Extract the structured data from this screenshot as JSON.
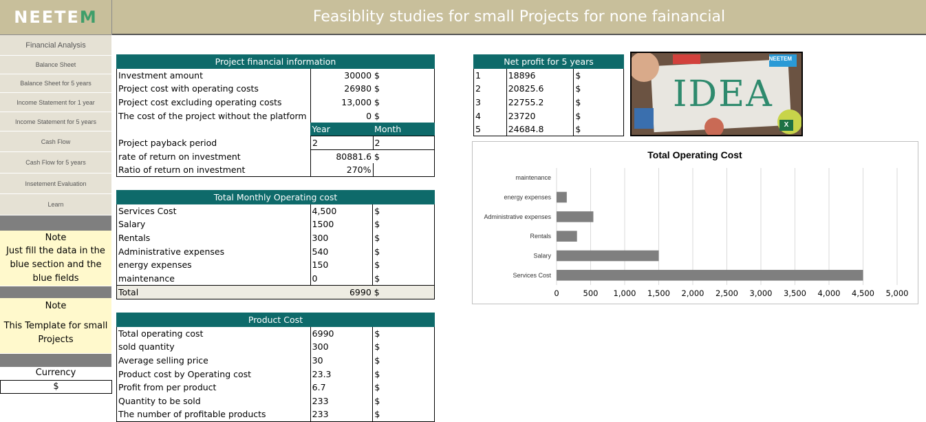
{
  "brand": {
    "logo_text": "NEETE",
    "logo_m": "M"
  },
  "header": {
    "title": "Feasiblity studies for small Projects for none fainancial"
  },
  "sidebar": {
    "items": [
      {
        "label": "Financial Analysis"
      },
      {
        "label": "Balance Sheet"
      },
      {
        "label": "Balance Sheet for 5 years"
      },
      {
        "label": "Income Statement for 1 year"
      },
      {
        "label": "Income Statement for 5 years"
      },
      {
        "label": "Cash Flow"
      },
      {
        "label": "Cash Flow for 5 years"
      },
      {
        "label": "Insetement Evaluation"
      },
      {
        "label": "Learn"
      }
    ],
    "note1_title": "Note",
    "note1_body": "Just fill the data in the blue section and the blue fields",
    "note2_title": "Note",
    "note2_body": "This Template for small Projects",
    "currency_label": "Currency",
    "currency_value": "$"
  },
  "project_info": {
    "title": "Project financial information",
    "rows": [
      {
        "label": "Investment amount",
        "value": "30000",
        "unit": "$"
      },
      {
        "label": "Project cost with operating costs",
        "value": "26980",
        "unit": "$"
      },
      {
        "label": "Project cost excluding operating costs",
        "value": "13,000",
        "unit": "$"
      },
      {
        "label": "The cost of the project without the platform",
        "value": "0",
        "unit": "$"
      }
    ],
    "year_header": "Year",
    "month_header": "Month",
    "payback_label": "Project payback period",
    "payback_year": "2",
    "payback_month": "2",
    "rate_label": "rate of return on investment",
    "rate_value": "80881.6",
    "rate_unit": "$",
    "ratio_label": "Ratio of return on investment",
    "ratio_value": "270%"
  },
  "operating_cost": {
    "title": "Total Monthly Operating cost",
    "rows": [
      {
        "label": "Services Cost",
        "value": "4,500",
        "unit": "$"
      },
      {
        "label": "Salary",
        "value": "1500",
        "unit": "$"
      },
      {
        "label": "Rentals",
        "value": "300",
        "unit": "$"
      },
      {
        "label": "Administrative expenses",
        "value": "540",
        "unit": "$"
      },
      {
        "label": "energy expenses",
        "value": "150",
        "unit": "$"
      },
      {
        "label": "maintenance",
        "value": "0",
        "unit": "$"
      }
    ],
    "total_label": "Total",
    "total_value": "6990",
    "total_unit": "$"
  },
  "product_cost": {
    "title": "Product Cost",
    "rows": [
      {
        "label": "Total operating cost",
        "value": "6990",
        "unit": "$"
      },
      {
        "label": "sold quantity",
        "value": "300",
        "unit": "$"
      },
      {
        "label": "Average selling price",
        "value": "30",
        "unit": "$"
      },
      {
        "label": "Product cost by Operating cost",
        "value": "23.3",
        "unit": "$"
      },
      {
        "label": "Profit from per product",
        "value": "6.7",
        "unit": "$"
      },
      {
        "label": "Quantity to be sold",
        "value": "233",
        "unit": "$"
      },
      {
        "label": "The number of profitable products",
        "value": "233",
        "unit": "$"
      }
    ]
  },
  "net_profit": {
    "title": "Net profit for 5 years",
    "rows": [
      {
        "year": "1",
        "value": "18896",
        "unit": "$"
      },
      {
        "year": "2",
        "value": "20825.6",
        "unit": "$"
      },
      {
        "year": "3",
        "value": "22755.2",
        "unit": "$"
      },
      {
        "year": "4",
        "value": "23720",
        "unit": "$"
      },
      {
        "year": "5",
        "value": "24684.8",
        "unit": "$"
      }
    ]
  },
  "image": {
    "text": "IDEA",
    "brand": "NEETEM",
    "badge": "X"
  },
  "chart_data": {
    "type": "bar",
    "orientation": "horizontal",
    "title": "Total Operating Cost",
    "categories": [
      "maintenance",
      "energy expenses",
      "Administrative expenses",
      "Rentals",
      "Salary",
      "Services Cost"
    ],
    "values": [
      0,
      150,
      540,
      300,
      1500,
      4500
    ],
    "xlim": [
      0,
      5000
    ],
    "xticks": [
      "0",
      "500",
      "1,000",
      "1,500",
      "2,000",
      "2,500",
      "3,000",
      "3,500",
      "4,000",
      "4,500",
      "5,000"
    ],
    "grid": true,
    "bar_color": "#7f7f7f",
    "xlabel": "",
    "ylabel": ""
  },
  "colors": {
    "header": "#c8bf9b",
    "table_head": "#0e6a6a",
    "note_bg": "#fff9cc",
    "nav_bg": "#e5e1d4"
  }
}
